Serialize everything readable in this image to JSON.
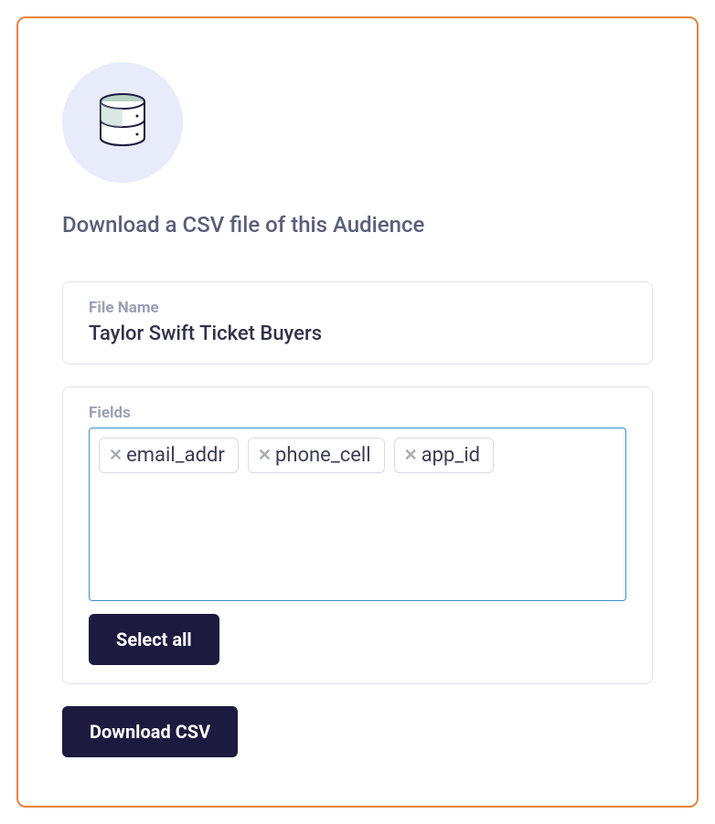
{
  "heading": "Download a CSV file of this Audience",
  "fileName": {
    "label": "File Name",
    "value": "Taylor Swift Ticket Buyers"
  },
  "fields": {
    "label": "Fields",
    "selected": [
      "email_addr",
      "phone_cell",
      "app_id"
    ],
    "selectAllLabel": "Select all"
  },
  "downloadButtonLabel": "Download CSV"
}
